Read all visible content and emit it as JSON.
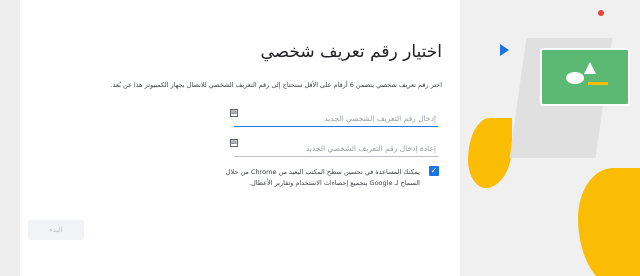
{
  "dialog": {
    "title": "اختيار رقم تعريف شخصي",
    "description": "اختر رقم تعريف شخصي يتضمن 6 أرقام على الأقل ستحتاج إلى رقم التعريف الشخصي للاتصال بجهاز الكمبيوتر هذا عن بُعد.",
    "pin_placeholder": "إدخال رقم التعريف الشخصي الجديد",
    "pin_confirm_placeholder": "إعادة إدخال رقم التعريف الشخصي الجديد",
    "checkbox_text": "يمكنك المساعدة في تحسين سطح المكتب البعيد من Chrome من خلال السماح لـ Google بتجميع إحصاءات الاستخدام وتقارير الأعطال.",
    "checkbox_checked": true,
    "start_label": "البدء"
  },
  "colors": {
    "accent": "#1a73e8",
    "illustration_green": "#5bb974",
    "illustration_yellow": "#fbbc04",
    "illustration_red": "#ea4335"
  },
  "icons": {
    "field_icon": "keyboard-icon",
    "checkbox_icon": "checkmark-icon"
  }
}
